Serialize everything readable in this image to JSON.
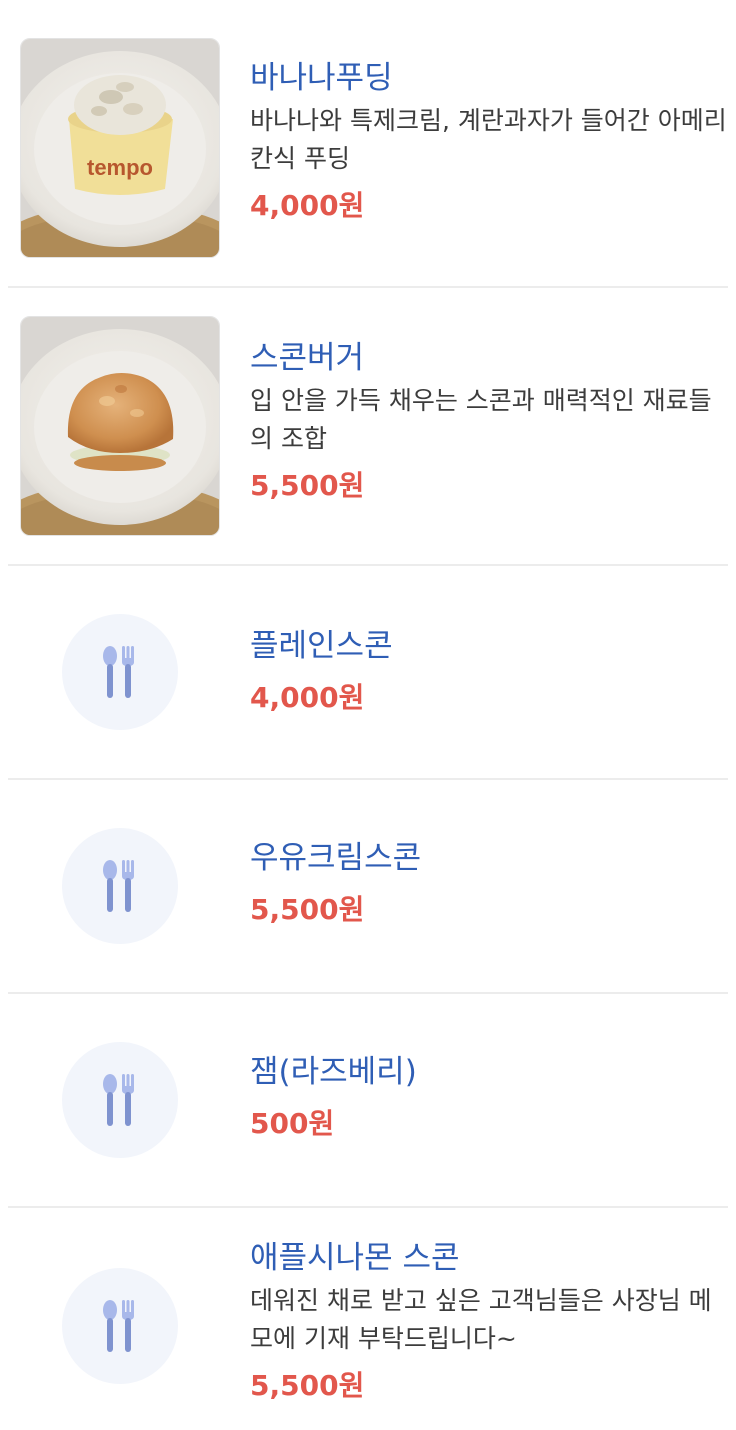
{
  "menu": {
    "items": [
      {
        "name": "바나나푸딩",
        "description": "바나나와 특제크림, 계란과자가 들어간 아메리칸식 푸딩",
        "price": "4,000원",
        "image": "banana-pudding-photo"
      },
      {
        "name": "스콘버거",
        "description": "입 안을 가득 채우는 스콘과 매력적인 재료들의 조합",
        "price": "5,500원",
        "image": "scone-burger-photo"
      },
      {
        "name": "플레인스콘",
        "description": "",
        "price": "4,000원",
        "image": "utensils-icon"
      },
      {
        "name": "우유크림스콘",
        "description": "",
        "price": "5,500원",
        "image": "utensils-icon"
      },
      {
        "name": "잼(라즈베리)",
        "description": "",
        "price": "500원",
        "image": "utensils-icon"
      },
      {
        "name": "애플시나몬 스콘",
        "description": "데워진 채로 받고 싶은 고객님들은 사장님 메모에 기재 부탁드립니다~",
        "price": "5,500원",
        "image": "utensils-icon"
      }
    ]
  },
  "colors": {
    "name": "#2f5eb5",
    "price": "#e2574c",
    "description": "#3c3c3c",
    "placeholder_bg": "#f2f5fb",
    "utensil": "#7f93cf"
  },
  "photo_labels": {
    "cup_brand": "tempo"
  }
}
